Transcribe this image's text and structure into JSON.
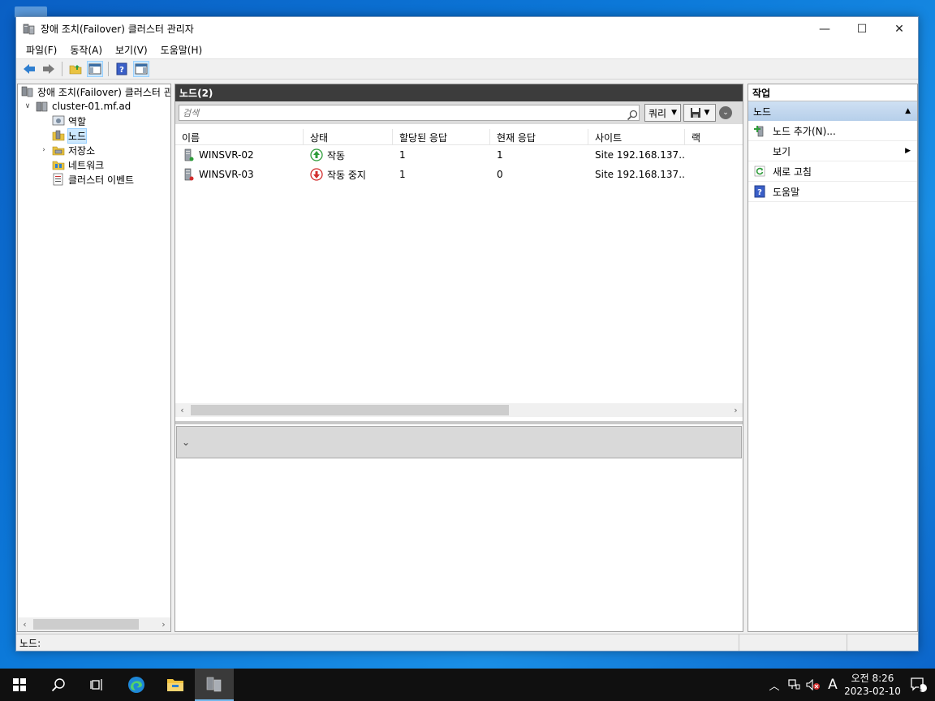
{
  "window": {
    "title": "장애 조치(Failover) 클러스터 관리자",
    "controls": {
      "minimize": "—",
      "maximize": "☐",
      "close": "✕"
    }
  },
  "menu": [
    "파일(F)",
    "동작(A)",
    "보기(V)",
    "도움말(H)"
  ],
  "tree": {
    "root": "장애 조치(Failover) 클러스터 관",
    "cluster": "cluster-01.mf.ad",
    "items": [
      {
        "label": "역할"
      },
      {
        "label": "노드"
      },
      {
        "label": "저장소"
      },
      {
        "label": "네트워크"
      },
      {
        "label": "클러스터 이벤트"
      }
    ]
  },
  "center": {
    "header": "노드(2)",
    "search_placeholder": "검색",
    "query_label": "쿼리",
    "columns": [
      "이름",
      "상태",
      "할당된 응답",
      "현재 응답",
      "사이트",
      "랙"
    ],
    "rows": [
      {
        "name": "WINSVR-02",
        "status": "작동",
        "assigned": "1",
        "current": "1",
        "site": "Site 192.168.137.…",
        "rack": ""
      },
      {
        "name": "WINSVR-03",
        "status": "작동 중지",
        "assigned": "1",
        "current": "0",
        "site": "Site 192.168.137.…",
        "rack": ""
      }
    ]
  },
  "actions": {
    "header": "작업",
    "section": "노드",
    "items": [
      {
        "label": "노드 추가(N)..."
      },
      {
        "label": "보기"
      },
      {
        "label": "새로 고침"
      },
      {
        "label": "도움말"
      }
    ]
  },
  "statusbar": {
    "text": "노드:"
  },
  "taskbar": {
    "clock_time": "오전 8:26",
    "clock_date": "2023-02-10",
    "ime": "A",
    "notif_count": "1"
  },
  "colors": {
    "accent": "#0078d7",
    "header_dark": "#3c3c3c",
    "status_up": "#2e9c3a",
    "status_down": "#d22d2d"
  }
}
